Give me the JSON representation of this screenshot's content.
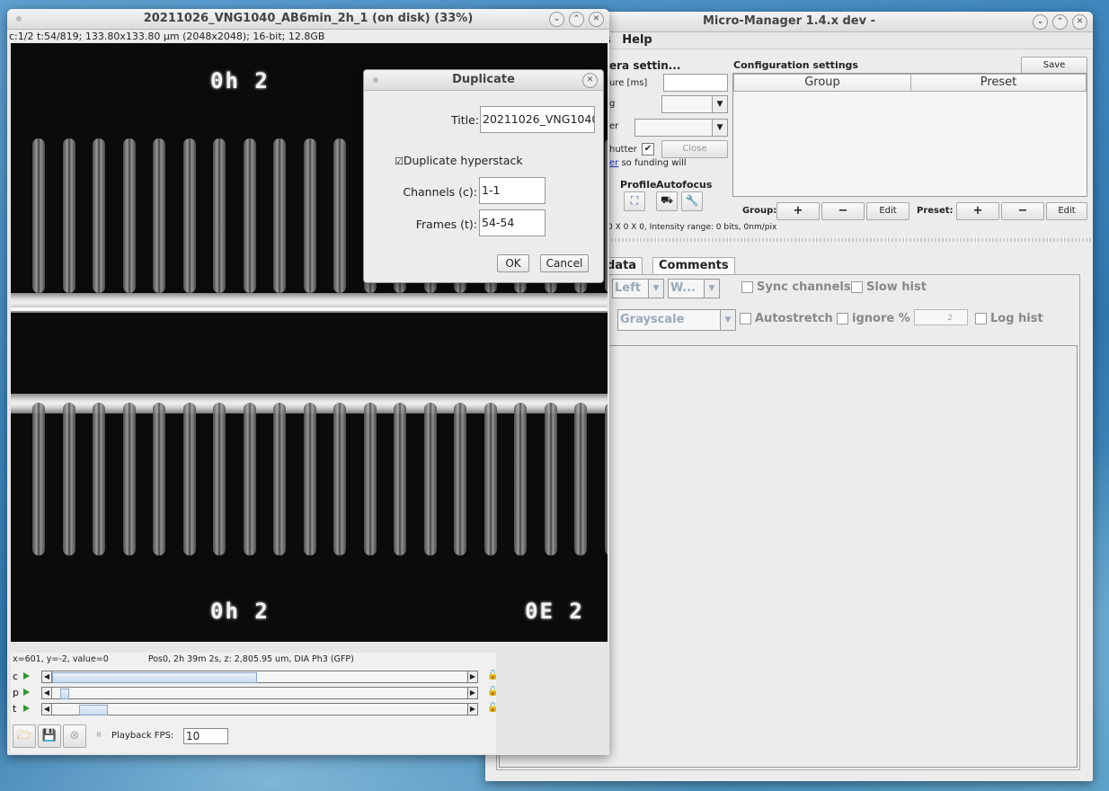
{
  "micromanager": {
    "title": "Micro-Manager 1.4.x dev -",
    "menu": [
      "s",
      "Help"
    ],
    "camera_section_title": "era settin...",
    "labels": {
      "exposure": "ure [ms]",
      "binning": "g",
      "shutter": "er",
      "auto_shutter": "hutter",
      "funding_link": "er",
      "funding_text": " so funding will",
      "profile": "Profile",
      "autofocus": "Autofocus",
      "image_info": "0 X 0 X 0, Intensity range: 0 bits, 0nm/pix"
    },
    "close_button": "Close",
    "config": {
      "title": "Configuration settings",
      "save_button": "Save",
      "col_group": "Group",
      "col_preset": "Preset",
      "group_label": "Group:",
      "preset_label": "Preset:",
      "add": "+",
      "remove": "−",
      "edit": "Edit"
    },
    "tabs": [
      "data",
      "Comments"
    ],
    "display": {
      "channel_mode": "Left",
      "window_mode": "W...",
      "sync_channels": "Sync channels",
      "slow_hist": "Slow hist",
      "colormap": "Grayscale",
      "autostretch": "Autostretch",
      "ignore_pct": "ignore %",
      "ignore_value": "2",
      "log_hist": "Log hist"
    }
  },
  "image_window": {
    "title": "20211026_VNG1040_AB6min_2h_1 (on disk) (33%)",
    "info": "c:1/2 t:54/819; 133.80x133.80 µm (2048x2048); 16-bit; 12.8GB",
    "overlay_labels": {
      "top_left": "0h 2",
      "bottom_left": "0h 2",
      "bottom_right": "0E 2"
    },
    "status": "x=601, y=-2, value=0",
    "position_info": "Pos0, 2h 39m 2s, z: 2,805.95 um,  DIA Ph3 (GFP)",
    "sliders": [
      {
        "label": "c",
        "position": 0.45
      },
      {
        "label": "p",
        "position": 0.02
      },
      {
        "label": "t",
        "position": 0.07
      }
    ],
    "playback_label": "Playback FPS:",
    "playback_fps": "10"
  },
  "duplicate_dialog": {
    "title": "Duplicate",
    "title_label": "Title:",
    "title_value": "20211026_VNG1040",
    "duplicate_hyperstack": "Duplicate hyperstack",
    "channels_label": "Channels (c):",
    "channels_value": "1-1",
    "frames_label": "Frames (t):",
    "frames_value": "54-54",
    "ok": "OK",
    "cancel": "Cancel"
  }
}
